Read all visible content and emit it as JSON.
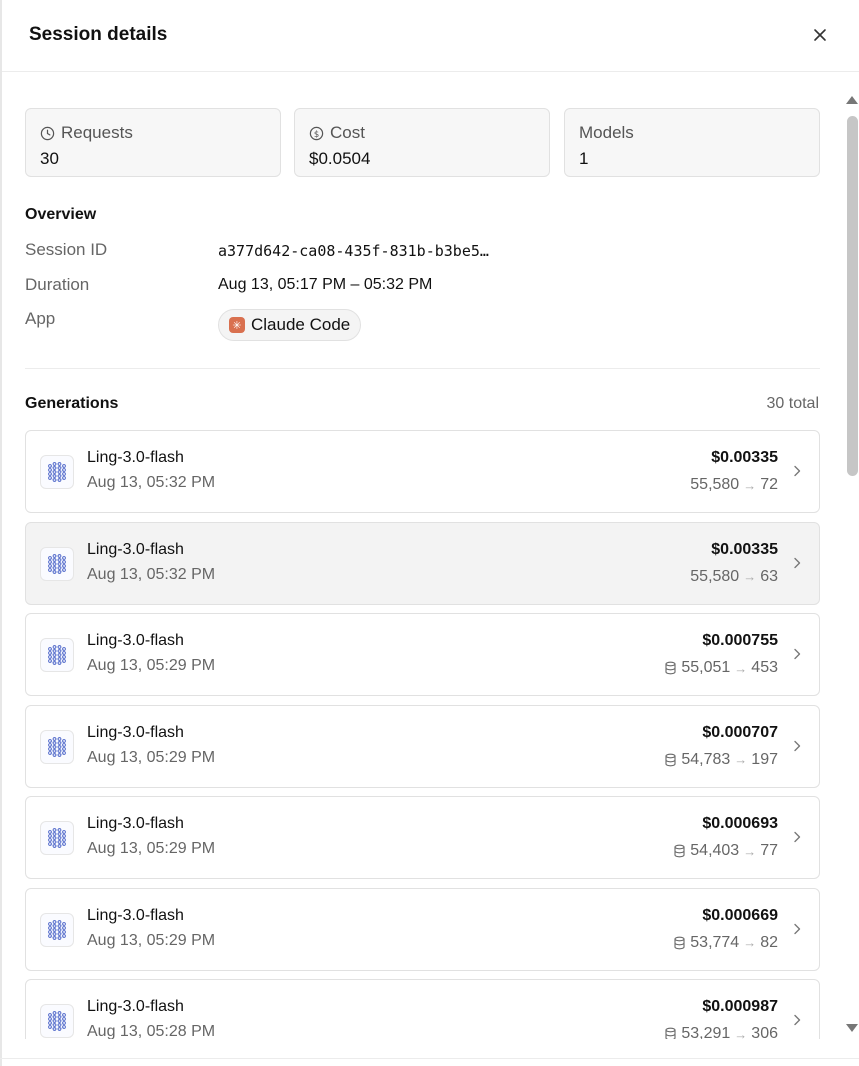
{
  "header": {
    "title": "Session details"
  },
  "stats": {
    "requests": {
      "label": "Requests",
      "value": "30"
    },
    "cost": {
      "label": "Cost",
      "value": "$0.0504"
    },
    "models": {
      "label": "Models",
      "value": "1"
    }
  },
  "overview": {
    "title": "Overview",
    "session_id": {
      "label": "Session ID",
      "value": "a377d642-ca08-435f-831b-b3be5…"
    },
    "duration": {
      "label": "Duration",
      "value": "Aug 13, 05:17 PM – 05:32 PM"
    },
    "app": {
      "label": "App",
      "value": "Claude Code"
    }
  },
  "generations": {
    "title": "Generations",
    "count": "30 total",
    "items": [
      {
        "model": "Ling-3.0-flash",
        "time": "Aug 13, 05:32 PM",
        "cost": "$0.00335",
        "input": "55,580",
        "output": "72",
        "cached": false
      },
      {
        "model": "Ling-3.0-flash",
        "time": "Aug 13, 05:32 PM",
        "cost": "$0.00335",
        "input": "55,580",
        "output": "63",
        "cached": false
      },
      {
        "model": "Ling-3.0-flash",
        "time": "Aug 13, 05:29 PM",
        "cost": "$0.000755",
        "input": "55,051",
        "output": "453",
        "cached": true
      },
      {
        "model": "Ling-3.0-flash",
        "time": "Aug 13, 05:29 PM",
        "cost": "$0.000707",
        "input": "54,783",
        "output": "197",
        "cached": true
      },
      {
        "model": "Ling-3.0-flash",
        "time": "Aug 13, 05:29 PM",
        "cost": "$0.000693",
        "input": "54,403",
        "output": "77",
        "cached": true
      },
      {
        "model": "Ling-3.0-flash",
        "time": "Aug 13, 05:29 PM",
        "cost": "$0.000669",
        "input": "53,774",
        "output": "82",
        "cached": true
      },
      {
        "model": "Ling-3.0-flash",
        "time": "Aug 13, 05:28 PM",
        "cost": "$0.000987",
        "input": "53,291",
        "output": "306",
        "cached": true
      }
    ]
  },
  "icons": {
    "close": "close-icon",
    "requests": "clock-icon",
    "cost": "dollar-circle-icon",
    "cache": "database-icon",
    "chevron": "chevron-right-icon",
    "model": "neural-network-icon"
  }
}
